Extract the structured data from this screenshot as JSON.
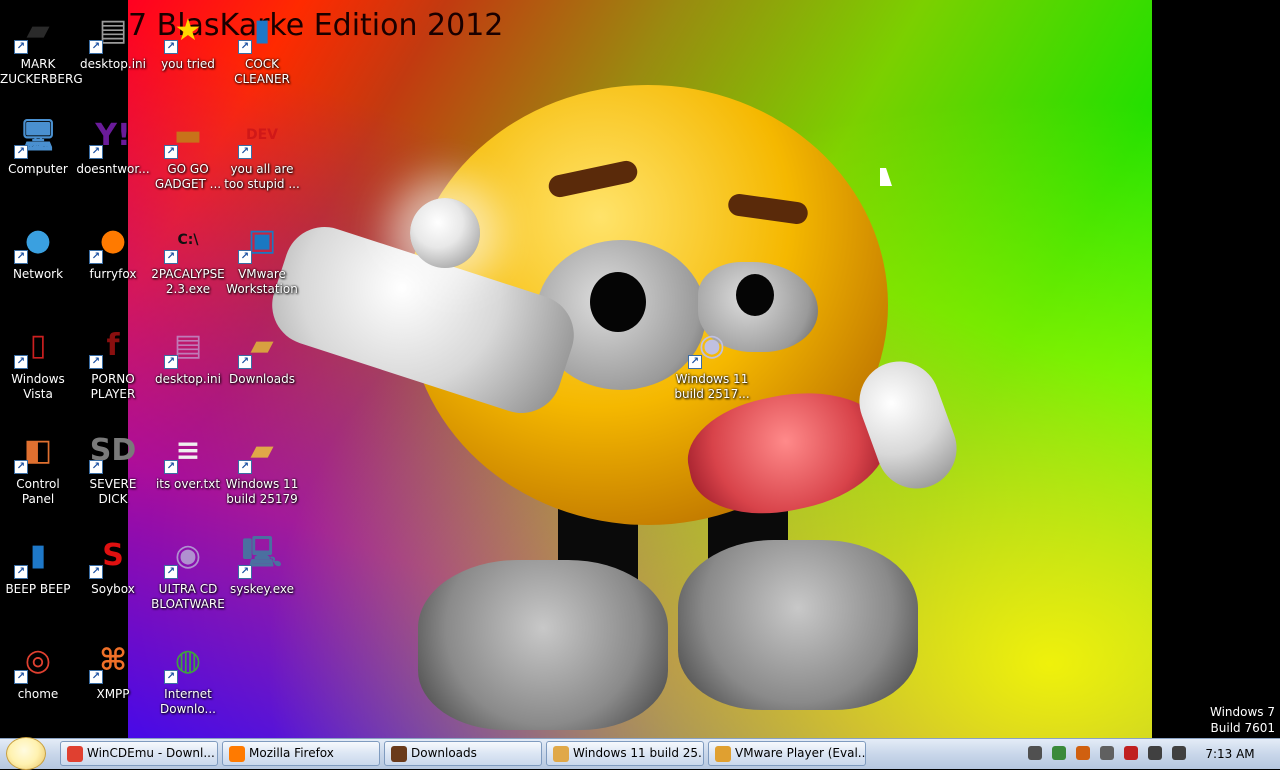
{
  "wallpaper": {
    "title": "7 BlasKarke Edition 2012"
  },
  "desktop_icons": [
    {
      "name": "desktop-icon-mark-zuckerberg",
      "label": "MARK ZUCKERBERG",
      "icon": "folder-person-icon",
      "color": "#2a2a2a"
    },
    {
      "name": "desktop-icon-desktop-ini-1",
      "label": "desktop.ini",
      "icon": "ini-file-icon",
      "color": "#9a9a9a"
    },
    {
      "name": "desktop-icon-you-tried",
      "label": "you tried",
      "icon": "star-icon",
      "color": "#ffd700"
    },
    {
      "name": "desktop-icon-cock-cleaner",
      "label": "COCK CLEANER",
      "icon": "blue-slab-icon",
      "color": "#1e78c8"
    },
    {
      "name": "desktop-icon-computer",
      "label": "Computer",
      "icon": "computer-icon",
      "color": "#4a90d0"
    },
    {
      "name": "desktop-icon-doesntwork",
      "label": "doesntwor...",
      "icon": "yahoo-messenger-icon",
      "color": "#6a1b9a"
    },
    {
      "name": "desktop-icon-go-go-gadget",
      "label": "GO GO GADGET ...",
      "icon": "briefcase-icon",
      "color": "#c8721a"
    },
    {
      "name": "desktop-icon-you-all-are-too-stupid",
      "label": "you all are too stupid ...",
      "icon": "dev-cpp-icon",
      "color": "#d01818"
    },
    {
      "name": "desktop-icon-network",
      "label": "Network",
      "icon": "globe-icon",
      "color": "#3aa0e0"
    },
    {
      "name": "desktop-icon-furryfox",
      "label": "furryfox",
      "icon": "firefox-icon",
      "color": "#ff7a00"
    },
    {
      "name": "desktop-icon-2pacalypse",
      "label": "2PACALYPSE 2.3.exe",
      "icon": "command-prompt-icon",
      "color": "#111111"
    },
    {
      "name": "desktop-icon-vmware-workstation",
      "label": "VMware Workstation",
      "icon": "vmware-icon",
      "color": "#1a78c2"
    },
    {
      "name": "desktop-icon-windows-vista",
      "label": "Windows Vista",
      "icon": "recycle-bin-icon",
      "color": "#cc2020"
    },
    {
      "name": "desktop-icon-porno-player",
      "label": "PORNO PLAYER",
      "icon": "flash-icon",
      "color": "#8a0f0f"
    },
    {
      "name": "desktop-icon-desktop-ini-2",
      "label": "desktop.ini",
      "icon": "ini-file-icon",
      "color": "#c07ab8"
    },
    {
      "name": "desktop-icon-downloads",
      "label": "Downloads",
      "icon": "downloads-folder-icon",
      "color": "#d8a040"
    },
    {
      "name": "desktop-icon-control-panel",
      "label": "Control Panel",
      "icon": "control-panel-icon",
      "color": "#e07030"
    },
    {
      "name": "desktop-icon-severe-dick",
      "label": "SEVERE DICK",
      "icon": "sd-gear-icon",
      "color": "#7a7a7a"
    },
    {
      "name": "desktop-icon-its-over",
      "label": "its over.txt",
      "icon": "text-file-icon",
      "color": "#f0f0f0"
    },
    {
      "name": "desktop-icon-windows-11-folder",
      "label": "Windows 11 build 25179",
      "icon": "folder-icon",
      "color": "#e0a848"
    },
    {
      "name": "desktop-icon-beep-beep",
      "label": "BEEP BEEP",
      "icon": "blue-slab-icon",
      "color": "#1e78c8"
    },
    {
      "name": "desktop-icon-soybox",
      "label": "Soybox",
      "icon": "s-logo-icon",
      "color": "#e01010"
    },
    {
      "name": "desktop-icon-ultra-cd-bloatware",
      "label": "ULTRA CD BLOATWARE",
      "icon": "cd-icon",
      "color": "#b090d0"
    },
    {
      "name": "desktop-icon-syskey",
      "label": "syskey.exe",
      "icon": "syskey-computer-icon",
      "color": "#4a70a0"
    },
    {
      "name": "desktop-icon-chome",
      "label": "chome",
      "icon": "chrome-icon",
      "color": "#e04030"
    },
    {
      "name": "desktop-icon-xmpp",
      "label": "XMPP",
      "icon": "xampp-icon",
      "color": "#f07028"
    },
    {
      "name": "desktop-icon-internet-download",
      "label": "Internet Downlo...",
      "icon": "idm-globe-icon",
      "color": "#40a040"
    },
    {
      "name": "desktop-icon-windows-11-iso",
      "label": "Windows 11 build 2517...",
      "icon": "iso-disc-icon",
      "color": "#c0c0e0"
    }
  ],
  "watermark": {
    "line1": "Windows 7",
    "line2": "Build 7601"
  },
  "taskbar": {
    "start_icon": "start-orb-icon",
    "tasks": [
      {
        "label": "WinCDEmu - Downl...",
        "icon": "chrome-icon",
        "color": "#e04030"
      },
      {
        "label": "Mozilla Firefox",
        "icon": "firefox-icon",
        "color": "#ff7a00"
      },
      {
        "label": "Downloads",
        "icon": "folder-icon",
        "color": "#6a3a1a"
      },
      {
        "label": "Windows 11 build 25...",
        "icon": "folder-icon",
        "color": "#e0a848"
      },
      {
        "label": "VMware Player (Eval...",
        "icon": "vmware-icon",
        "color": "#e0a030"
      }
    ],
    "tray_icons": [
      {
        "name": "window-tray-icon",
        "color": "#505050"
      },
      {
        "name": "network-tray-icon",
        "color": "#3a8a3a"
      },
      {
        "name": "search-tray-icon",
        "color": "#d06010"
      },
      {
        "name": "minus-tray-icon",
        "color": "#606060"
      },
      {
        "name": "action-center-tray-icon",
        "color": "#c02020"
      },
      {
        "name": "display-tray-icon",
        "color": "#404040"
      },
      {
        "name": "volume-tray-icon",
        "color": "#404040"
      }
    ],
    "clock": "7:13 AM"
  }
}
